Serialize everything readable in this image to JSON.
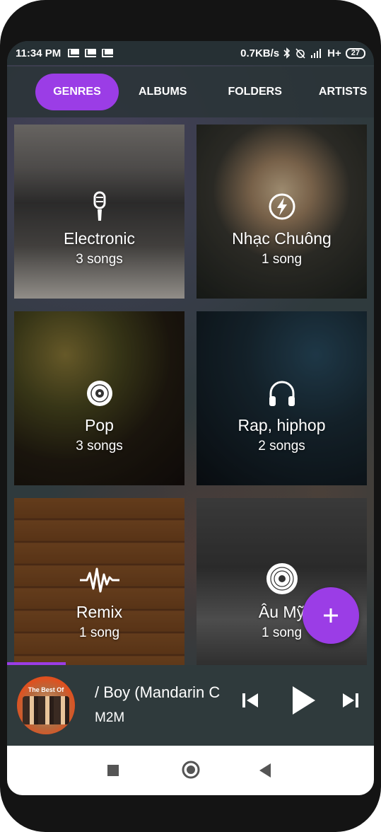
{
  "status_bar": {
    "time": "11:34 PM",
    "notifications": [
      "mail-icon",
      "mail-icon",
      "mail-icon"
    ],
    "network_speed": "0.7KB/s",
    "network_type": "H+",
    "battery": "27"
  },
  "tabs": [
    {
      "label": "GENRES",
      "active": true
    },
    {
      "label": "ALBUMS",
      "active": false
    },
    {
      "label": "FOLDERS",
      "active": false
    },
    {
      "label": "ARTISTS",
      "active": false
    }
  ],
  "genres": [
    {
      "name": "Electronic",
      "count": "3 songs",
      "icon": "microphone-icon"
    },
    {
      "name": "Nhạc Chuông",
      "count": "1 song",
      "icon": "lightning-icon"
    },
    {
      "name": "Pop",
      "count": "3 songs",
      "icon": "vinyl-icon"
    },
    {
      "name": "Rap, hiphop",
      "count": "2 songs",
      "icon": "headphones-icon"
    },
    {
      "name": "Remix",
      "count": "1 song",
      "icon": "soundwave-icon"
    },
    {
      "name": "Âu Mỹ",
      "count": "1 song",
      "icon": "record-icon"
    }
  ],
  "player": {
    "title": "/ Boy (Mandarin C",
    "artist": "M2M",
    "album_label": "The Best Of",
    "progress": 0.16
  },
  "colors": {
    "accent": "#9b3de6",
    "background": "#2f3a3d",
    "player_bg": "#2f3a3c"
  }
}
